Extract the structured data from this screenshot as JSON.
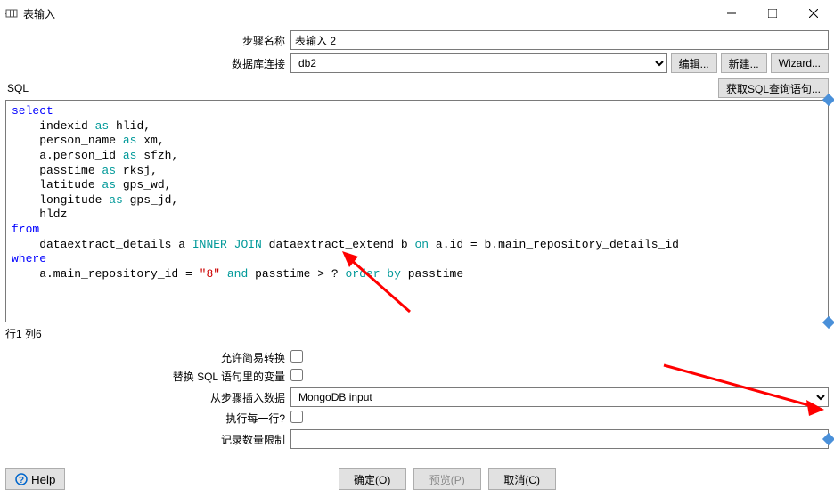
{
  "window": {
    "title": "表输入",
    "minimize": "—",
    "maximize": "☐",
    "close": "✕"
  },
  "form": {
    "step_name_label": "步骤名称",
    "step_name_value": "表输入 2",
    "conn_label": "数据库连接",
    "conn_value": "db2",
    "edit_btn": "编辑...",
    "new_btn": "新建...",
    "wizard_btn": "Wizard..."
  },
  "sql": {
    "label": "SQL",
    "get_sql_btn": "获取SQL查询语句...",
    "tokens": [
      {
        "t": "select",
        "c": "kw-blue"
      },
      {
        "t": "\n    indexid "
      },
      {
        "t": "as",
        "c": "kw-teal"
      },
      {
        "t": " hlid,\n    person_name "
      },
      {
        "t": "as",
        "c": "kw-teal"
      },
      {
        "t": " xm,\n    a.person_id "
      },
      {
        "t": "as",
        "c": "kw-teal"
      },
      {
        "t": " sfzh,\n    passtime "
      },
      {
        "t": "as",
        "c": "kw-teal"
      },
      {
        "t": " rksj,\n    latitude "
      },
      {
        "t": "as",
        "c": "kw-teal"
      },
      {
        "t": " gps_wd,\n    longitude "
      },
      {
        "t": "as",
        "c": "kw-teal"
      },
      {
        "t": " gps_jd,\n    hldz\n"
      },
      {
        "t": "from",
        "c": "kw-blue"
      },
      {
        "t": "\n    dataextract_details a "
      },
      {
        "t": "INNER JOIN",
        "c": "kw-teal"
      },
      {
        "t": " dataextract_extend b "
      },
      {
        "t": "on",
        "c": "kw-teal"
      },
      {
        "t": " a.id = b.main_repository_details_id\n"
      },
      {
        "t": "where",
        "c": "kw-blue"
      },
      {
        "t": "\n    a.main_repository_id = "
      },
      {
        "t": "\"8\"",
        "c": "kw-red"
      },
      {
        "t": " "
      },
      {
        "t": "and",
        "c": "kw-teal"
      },
      {
        "t": " passtime > ? "
      },
      {
        "t": "order by",
        "c": "kw-teal"
      },
      {
        "t": " passtime"
      }
    ]
  },
  "status_line": "行1 列6",
  "lower": {
    "lazy_label": "允许简易转换",
    "replace_vars_label": "替换 SQL 语句里的变量",
    "insert_from_label": "从步骤插入数据",
    "insert_from_value": "MongoDB input",
    "each_row_label": "执行每一行?",
    "limit_label": "记录数量限制",
    "limit_value": ""
  },
  "footer": {
    "help": "Help",
    "ok": "确定",
    "ok_key": "O",
    "preview": "预览",
    "preview_key": "P",
    "cancel": "取消",
    "cancel_key": "C"
  }
}
